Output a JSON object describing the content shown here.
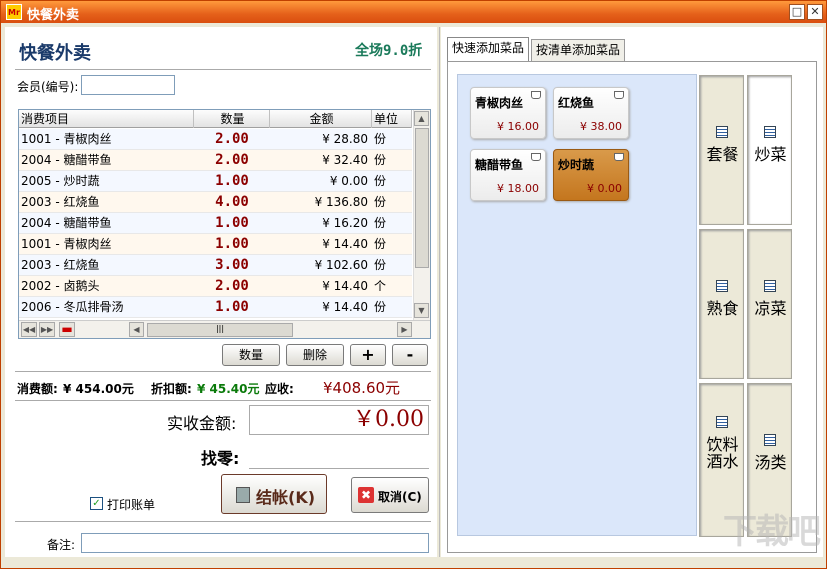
{
  "window": {
    "title": "快餐外卖",
    "icon_text": "Mr",
    "minimize": "□",
    "close": "✕"
  },
  "header": {
    "title": "快餐外卖",
    "discount": "全场9.0折"
  },
  "member": {
    "label": "会员(编号):",
    "value": ""
  },
  "order_table": {
    "columns": [
      "消费项目",
      "数量",
      "金额",
      "单位"
    ],
    "rows": [
      {
        "item": "1001 - 青椒肉丝",
        "qty": "2.00",
        "amount": "¥ 28.80",
        "unit": "份"
      },
      {
        "item": "2004 - 糖醋带鱼",
        "qty": "2.00",
        "amount": "¥ 32.40",
        "unit": "份"
      },
      {
        "item": "2005 - 炒时蔬",
        "qty": "1.00",
        "amount": "¥ 0.00",
        "unit": "份"
      },
      {
        "item": "2003 - 红烧鱼",
        "qty": "4.00",
        "amount": "¥ 136.80",
        "unit": "份"
      },
      {
        "item": "2004 - 糖醋带鱼",
        "qty": "1.00",
        "amount": "¥ 16.20",
        "unit": "份"
      },
      {
        "item": "1001 - 青椒肉丝",
        "qty": "1.00",
        "amount": "¥ 14.40",
        "unit": "份"
      },
      {
        "item": "2003 - 红烧鱼",
        "qty": "3.00",
        "amount": "¥ 102.60",
        "unit": "份"
      },
      {
        "item": "2002 - 卤鹅头",
        "qty": "2.00",
        "amount": "¥ 14.40",
        "unit": "个"
      },
      {
        "item": "2006 - 冬瓜排骨汤",
        "qty": "1.00",
        "amount": "¥ 14.40",
        "unit": "份"
      }
    ]
  },
  "actions": {
    "qty": "数量",
    "delete": "删除",
    "plus": "+",
    "minus": "-"
  },
  "totals": {
    "consume_label": "消费额:",
    "consume_value": "¥ 454.00元",
    "discount_label": "折扣额:",
    "discount_value": "¥ 45.40元",
    "due_label": "应收:",
    "due_value": "¥408.60元"
  },
  "payment": {
    "received_label": "实收金额:",
    "received_value": "￥0.00",
    "change_label": "找零:",
    "change_value": ""
  },
  "print_receipt": {
    "label": "打印账单",
    "checked": true
  },
  "buttons": {
    "checkout": "结帐(K)",
    "cancel": "取消(C)"
  },
  "remark": {
    "label": "备注:",
    "value": ""
  },
  "tabs": [
    "快速添加菜品",
    "按清单添加菜品"
  ],
  "dishes": [
    {
      "name": "青椒肉丝",
      "price": "¥ 16.00",
      "selected": false
    },
    {
      "name": "红烧鱼",
      "price": "¥ 38.00",
      "selected": false
    },
    {
      "name": "糖醋带鱼",
      "price": "¥ 18.00",
      "selected": false
    },
    {
      "name": "炒时蔬",
      "price": "¥ 0.00",
      "selected": true
    }
  ],
  "categories": [
    "套餐",
    "炒菜",
    "熟食",
    "凉菜",
    "饮料酒水",
    "汤类"
  ],
  "active_category": "炒菜",
  "watermark": "下载吧"
}
